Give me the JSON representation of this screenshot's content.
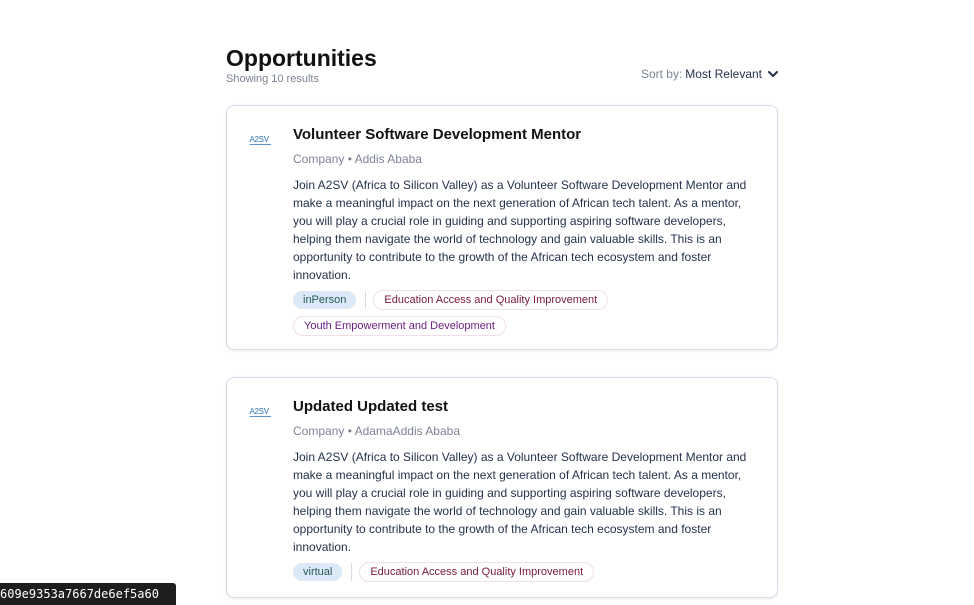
{
  "header": {
    "title": "Opportunities",
    "result_count": "Showing 10 results",
    "sort_label": "Sort by:",
    "sort_value": "Most Relevant"
  },
  "cards": [
    {
      "logo_text": "A2SV",
      "title": "Volunteer Software Development Mentor",
      "org": "Company",
      "separator": "•",
      "location": "Addis Ababa",
      "description": "Join A2SV (Africa to Silicon Valley) as a Volunteer Software Development Mentor and make a meaningful impact on the next generation of African tech talent. As a mentor, you will play a crucial role in guiding and supporting aspiring software developers, helping them navigate the world of technology and gain valuable skills. This is an opportunity to contribute to the growth of the African tech ecosystem and foster innovation.",
      "op_type": "inPerson",
      "categories": [
        "Education Access and Quality Improvement",
        "Youth Empowerment and Development"
      ]
    },
    {
      "logo_text": "A2SV",
      "title": "Updated Updated test",
      "org": "Company",
      "separator": "•",
      "location": "AdamaAddis Ababa",
      "description": "Join A2SV (Africa to Silicon Valley) as a Volunteer Software Development Mentor and make a meaningful impact on the next generation of African tech talent. As a mentor, you will play a crucial role in guiding and supporting aspiring software developers, helping them navigate the world of technology and gain valuable skills. This is an opportunity to contribute to the growth of the African tech ecosystem and foster innovation.",
      "op_type": "virtual",
      "categories": [
        "Education Access and Quality Improvement"
      ]
    }
  ],
  "id_badge": "609e9353a7667de6ef5a60",
  "colors": {
    "accent_text": "#25324b",
    "muted_text": "#7c8493",
    "op_tag_bg": "#dbe8f5",
    "category_tag_text": "#7a1a3a",
    "logo_blue": "#2c6fb7"
  },
  "icons": {
    "sort_chevron": "chevron-down-icon",
    "company_logo": "a2sv-logo-icon"
  }
}
